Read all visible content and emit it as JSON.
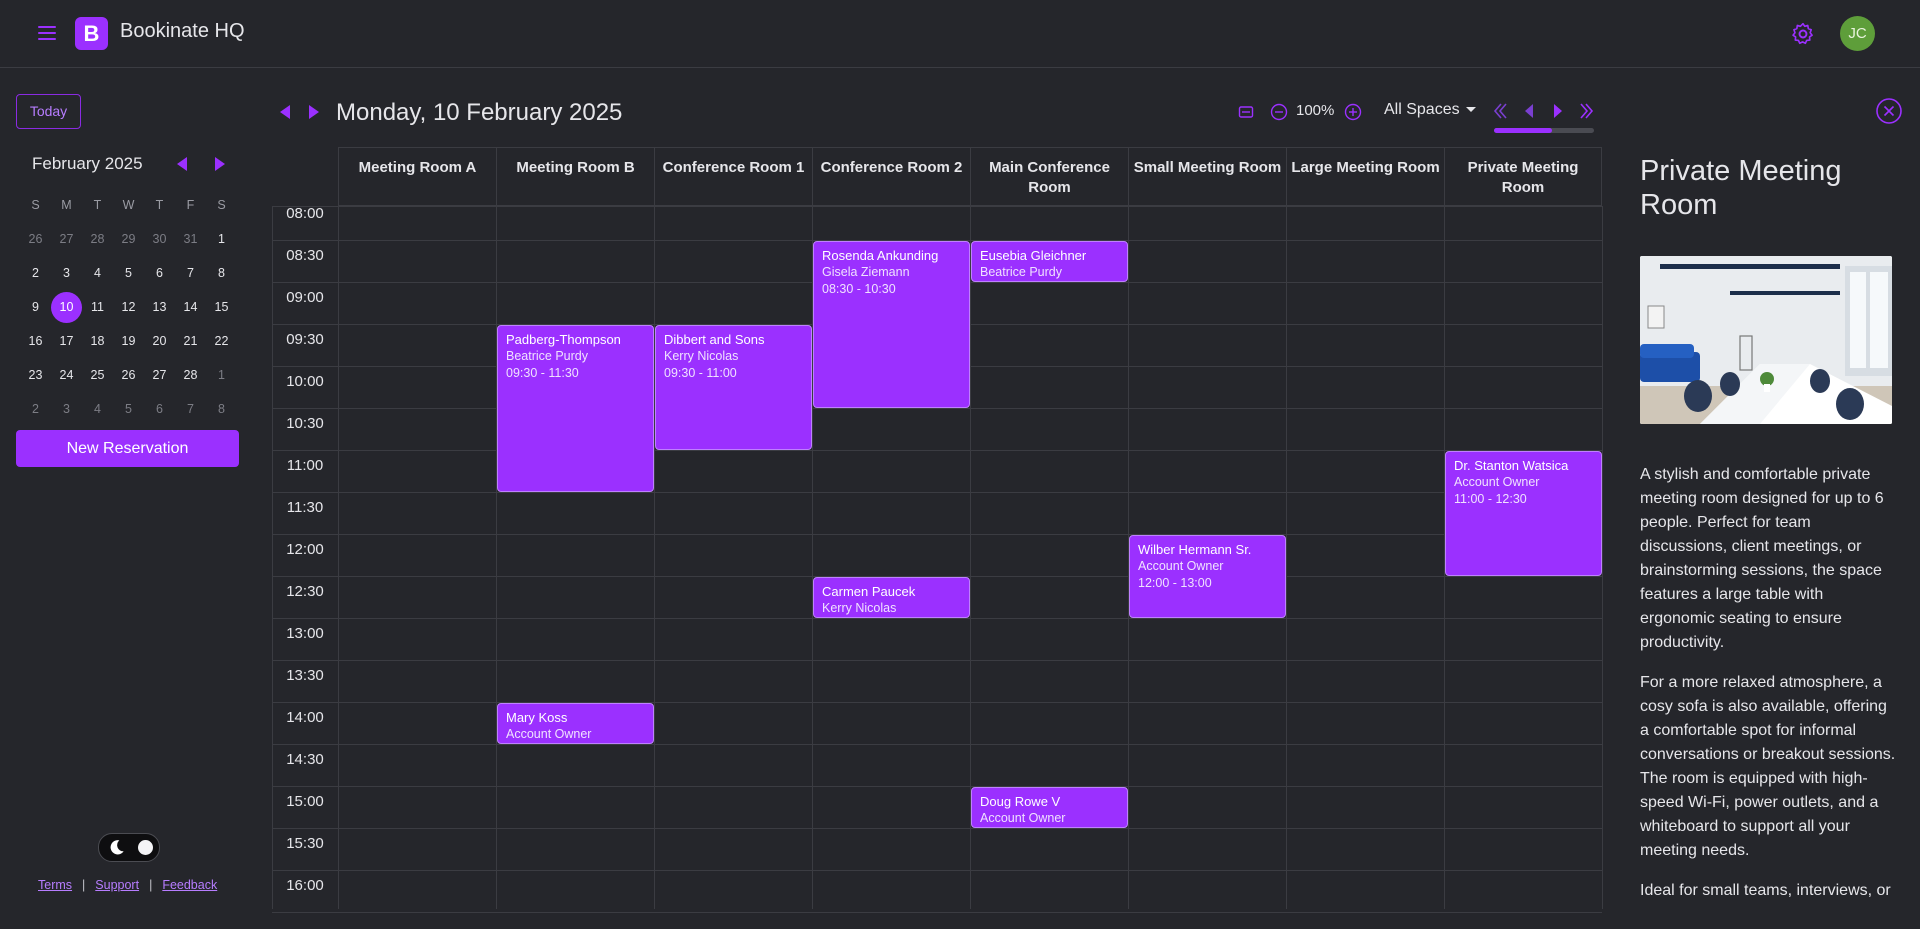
{
  "app": {
    "name": "Bookinate HQ",
    "logo_letter": "B",
    "user_initials": "JC",
    "accent": "#9b30ff"
  },
  "sidebar": {
    "today_label": "Today",
    "month_title": "February 2025",
    "weekday_headers": [
      "S",
      "M",
      "T",
      "W",
      "T",
      "F",
      "S"
    ],
    "weeks": [
      [
        "26",
        "27",
        "28",
        "29",
        "30",
        "31",
        "1"
      ],
      [
        "2",
        "3",
        "4",
        "5",
        "6",
        "7",
        "8"
      ],
      [
        "9",
        "10",
        "11",
        "12",
        "13",
        "14",
        "15"
      ],
      [
        "16",
        "17",
        "18",
        "19",
        "20",
        "21",
        "22"
      ],
      [
        "23",
        "24",
        "25",
        "26",
        "27",
        "28",
        "1"
      ],
      [
        "2",
        "3",
        "4",
        "5",
        "6",
        "7",
        "8"
      ]
    ],
    "selected_day": "10",
    "new_reservation_label": "New Reservation",
    "footer": {
      "terms": "Terms",
      "support": "Support",
      "feedback": "Feedback",
      "separator": "|"
    }
  },
  "schedule": {
    "date_title": "Monday, 10 February 2025",
    "zoom": "100%",
    "spaces_filter": "All Spaces",
    "rooms": [
      "Meeting Room A",
      "Meeting Room B",
      "Conference Room 1",
      "Conference Room 2",
      "Main Conference Room",
      "Small Meeting Room",
      "Large Meeting Room",
      "Private Meeting Room"
    ],
    "times": [
      "08:00",
      "08:30",
      "09:00",
      "09:30",
      "10:00",
      "10:30",
      "11:00",
      "11:30",
      "12:00",
      "12:30",
      "13:00",
      "13:30",
      "14:00",
      "14:30",
      "15:00",
      "15:30",
      "16:00"
    ],
    "events": [
      {
        "room": 3,
        "title": "Rosenda Ankunding",
        "person": "Gisela Ziemann",
        "time": "08:30 - 10:30",
        "start": "08:30",
        "end": "10:30"
      },
      {
        "room": 4,
        "title": "Eusebia Gleichner",
        "person": "Beatrice Purdy",
        "time": "",
        "start": "08:30",
        "end": "09:00"
      },
      {
        "room": 1,
        "title": "Padberg-Thompson",
        "person": "Beatrice Purdy",
        "time": "09:30 - 11:30",
        "start": "09:30",
        "end": "11:30"
      },
      {
        "room": 2,
        "title": "Dibbert and Sons",
        "person": "Kerry Nicolas",
        "time": "09:30 - 11:00",
        "start": "09:30",
        "end": "11:00"
      },
      {
        "room": 7,
        "title": "Dr. Stanton Watsica",
        "person": "Account Owner",
        "time": "11:00 - 12:30",
        "start": "11:00",
        "end": "12:30"
      },
      {
        "room": 5,
        "title": "Wilber Hermann Sr.",
        "person": "Account Owner",
        "time": "12:00 - 13:00",
        "start": "12:00",
        "end": "13:00"
      },
      {
        "room": 3,
        "title": "Carmen Paucek",
        "person": "Kerry Nicolas",
        "time": "",
        "start": "12:30",
        "end": "13:00"
      },
      {
        "room": 1,
        "title": "Mary Koss",
        "person": "Account Owner",
        "time": "",
        "start": "14:00",
        "end": "14:30"
      },
      {
        "room": 4,
        "title": "Doug Rowe V",
        "person": "Account Owner",
        "time": "",
        "start": "15:00",
        "end": "15:30"
      }
    ]
  },
  "panel": {
    "title": "Private Meeting Room",
    "paragraphs": [
      "A stylish and comfortable private meeting room designed for up to 6 people. Perfect for team discussions, client meetings, or brainstorming sessions, the space features a large table with ergonomic seating to ensure productivity.",
      "For a more relaxed atmosphere, a cosy sofa is also available, offering a comfortable spot for informal conversations or breakout sessions. The room is equipped with high-speed Wi-Fi, power outlets, and a whiteboard to support all your meeting needs.",
      "Ideal for small teams, interviews, or"
    ]
  }
}
